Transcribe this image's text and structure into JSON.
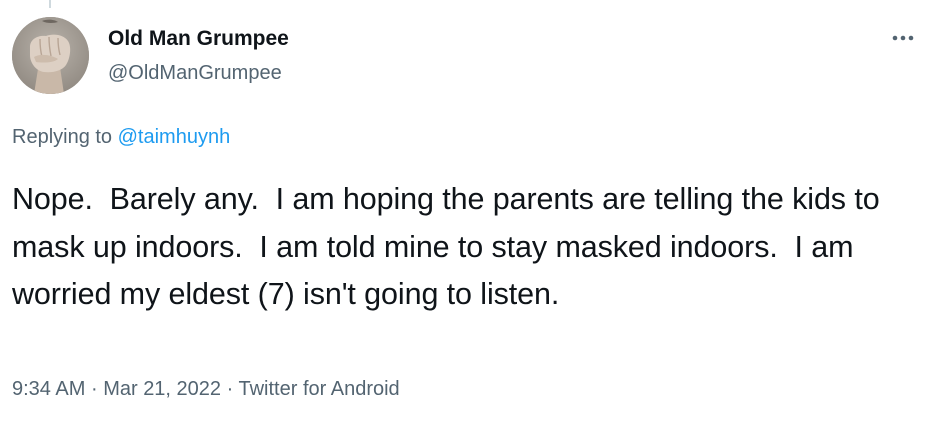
{
  "author": {
    "display_name": "Old Man Grumpee",
    "handle": "@OldManGrumpee",
    "avatar_icon": "fist-avatar"
  },
  "more_icon": "ellipsis-icon",
  "reply": {
    "prefix": "Replying to ",
    "to_handle": "@taimhuynh"
  },
  "tweet": {
    "text": "Nope.  Barely any.  I am hoping the parents are telling the kids to mask up indoors.  I am told mine to stay masked indoors.  I am worried my eldest (7) isn't going to listen."
  },
  "meta": {
    "time": "9:34 AM",
    "separator": "·",
    "date": "Mar 21, 2022",
    "source": "Twitter for Android"
  },
  "colors": {
    "text": "#0f1419",
    "secondary": "#536471",
    "link": "#1d9bf0"
  }
}
